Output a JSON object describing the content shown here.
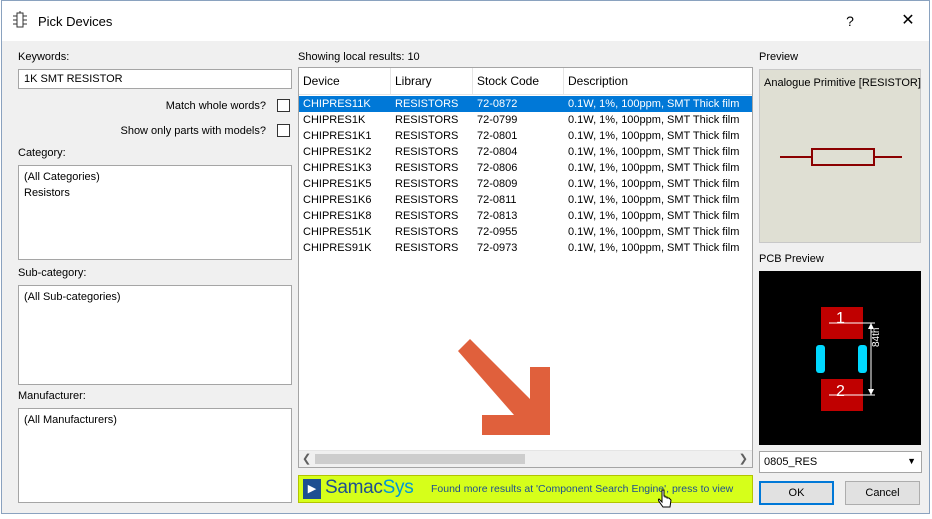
{
  "window": {
    "title": "Pick Devices",
    "help": "?",
    "close": "✕"
  },
  "keywords": {
    "label": "Keywords:",
    "value": "1K SMT RESISTOR"
  },
  "options": {
    "match_whole": "Match whole words?",
    "only_models": "Show only parts with models?"
  },
  "category": {
    "label": "Category:",
    "items": [
      "(All Categories)",
      "Resistors"
    ]
  },
  "subcategory": {
    "label": "Sub-category:",
    "items": [
      "(All Sub-categories)"
    ]
  },
  "manufacturer": {
    "label": "Manufacturer:",
    "items": [
      "(All Manufacturers)"
    ]
  },
  "results": {
    "status": "Showing local results: 10",
    "columns": [
      "Device",
      "Library",
      "Stock Code",
      "Description"
    ],
    "rows": [
      [
        "CHIPRES11K",
        "RESISTORS",
        "72-0872",
        "0.1W, 1%, 100ppm, SMT Thick film"
      ],
      [
        "CHIPRES1K",
        "RESISTORS",
        "72-0799",
        "0.1W, 1%, 100ppm, SMT Thick film"
      ],
      [
        "CHIPRES1K1",
        "RESISTORS",
        "72-0801",
        "0.1W, 1%, 100ppm, SMT Thick film"
      ],
      [
        "CHIPRES1K2",
        "RESISTORS",
        "72-0804",
        "0.1W, 1%, 100ppm, SMT Thick film"
      ],
      [
        "CHIPRES1K3",
        "RESISTORS",
        "72-0806",
        "0.1W, 1%, 100ppm, SMT Thick film"
      ],
      [
        "CHIPRES1K5",
        "RESISTORS",
        "72-0809",
        "0.1W, 1%, 100ppm, SMT Thick film"
      ],
      [
        "CHIPRES1K6",
        "RESISTORS",
        "72-0811",
        "0.1W, 1%, 100ppm, SMT Thick film"
      ],
      [
        "CHIPRES1K8",
        "RESISTORS",
        "72-0813",
        "0.1W, 1%, 100ppm, SMT Thick film"
      ],
      [
        "CHIPRES51K",
        "RESISTORS",
        "72-0955",
        "0.1W, 1%, 100ppm, SMT Thick film"
      ],
      [
        "CHIPRES91K",
        "RESISTORS",
        "72-0973",
        "0.1W, 1%, 100ppm, SMT Thick film"
      ]
    ],
    "selected_index": 0
  },
  "banner": {
    "brand_a": "Samac",
    "brand_b": "Sys",
    "text": "Found more results at 'Component Search Engine', press to view"
  },
  "preview": {
    "label": "Preview",
    "caption": "Analogue Primitive [RESISTOR]"
  },
  "pcb_preview": {
    "label": "PCB Preview",
    "pin1": "1",
    "pin2": "2",
    "dimension": "84th"
  },
  "package": {
    "value": "0805_RES"
  },
  "buttons": {
    "ok": "OK",
    "cancel": "Cancel"
  },
  "colors": {
    "selection": "#0078d7",
    "arrow": "#e0603c",
    "banner": "#d6ff1a",
    "pad": "#c00000",
    "resistor": "#8b0000"
  }
}
